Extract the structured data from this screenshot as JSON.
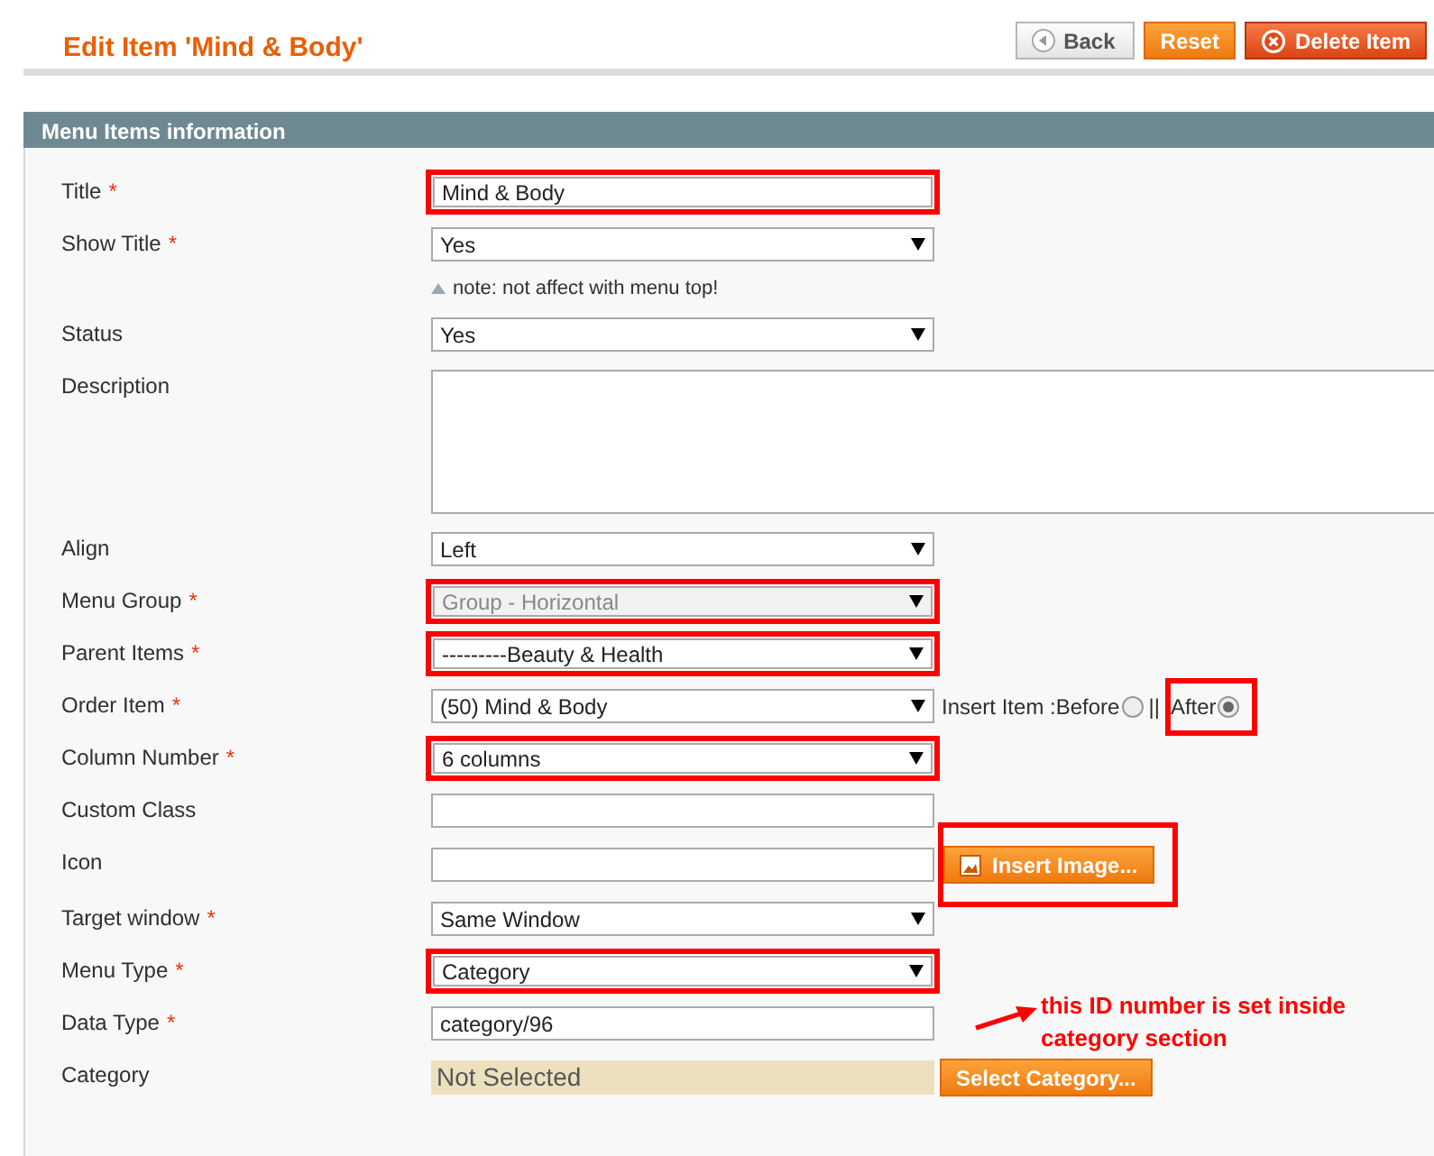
{
  "header": {
    "title": "Edit Item 'Mind & Body'",
    "buttons": [
      {
        "kind": "back",
        "label": "Back"
      },
      {
        "kind": "reset",
        "label": "Reset"
      },
      {
        "kind": "delete",
        "label": "Delete Item"
      }
    ]
  },
  "section": {
    "title": "Menu Items information"
  },
  "fields": [
    {
      "kind": "text",
      "label": "Title",
      "required_mark": "*",
      "value": "Mind & Body",
      "highlighted": true,
      "disabled": false
    },
    {
      "kind": "select",
      "label": "Show Title",
      "required_mark": "*",
      "value": "Yes",
      "highlighted": false,
      "disabled": false,
      "note": "note: not affect with menu top!"
    },
    {
      "kind": "select",
      "label": "Status",
      "value": "Yes",
      "highlighted": false,
      "disabled": false
    },
    {
      "kind": "textarea",
      "label": "Description",
      "highlighted": false,
      "disabled": false
    },
    {
      "kind": "select",
      "label": "Align",
      "value": "Left",
      "highlighted": false,
      "disabled": false
    },
    {
      "kind": "select",
      "label": "Menu Group",
      "required_mark": "*",
      "value": "Group - Horizontal",
      "highlighted": true,
      "disabled": true
    },
    {
      "kind": "select",
      "label": "Parent Items",
      "required_mark": "*",
      "value": "---------Beauty & Health",
      "highlighted": true,
      "disabled": false
    },
    {
      "kind": "select",
      "label": "Order Item",
      "required_mark": "*",
      "value": "(50) Mind & Body",
      "highlighted": false,
      "disabled": false,
      "insert": {
        "label": "Insert Item : ",
        "separator": "||",
        "options": [
          {
            "label": "Before",
            "selected": false,
            "highlighted": false
          },
          {
            "label": "After",
            "selected": true,
            "highlighted": true
          }
        ]
      }
    },
    {
      "kind": "select",
      "label": "Column Number",
      "required_mark": "*",
      "value": "6 columns",
      "highlighted": true,
      "disabled": false
    },
    {
      "kind": "text",
      "label": "Custom Class",
      "highlighted": false,
      "disabled": false
    },
    {
      "kind": "text",
      "label": "Icon",
      "highlighted": false,
      "disabled": false,
      "button": {
        "label": "Insert Image...",
        "highlighted": true
      }
    },
    {
      "kind": "select",
      "label": "Target window",
      "required_mark": "*",
      "value": "Same Window",
      "highlighted": false,
      "disabled": false
    },
    {
      "kind": "select",
      "label": "Menu Type",
      "required_mark": "*",
      "value": "Category",
      "highlighted": true,
      "disabled": false
    },
    {
      "kind": "text",
      "label": "Data Type",
      "required_mark": "*",
      "value": "category/96",
      "highlighted": false,
      "disabled": false,
      "annotation": "this ID number is set inside category section"
    },
    {
      "kind": "chooser",
      "label": "Category",
      "value": "Not Selected",
      "highlighted": false,
      "disabled": false,
      "button": {
        "label": "Select Category..."
      }
    }
  ]
}
